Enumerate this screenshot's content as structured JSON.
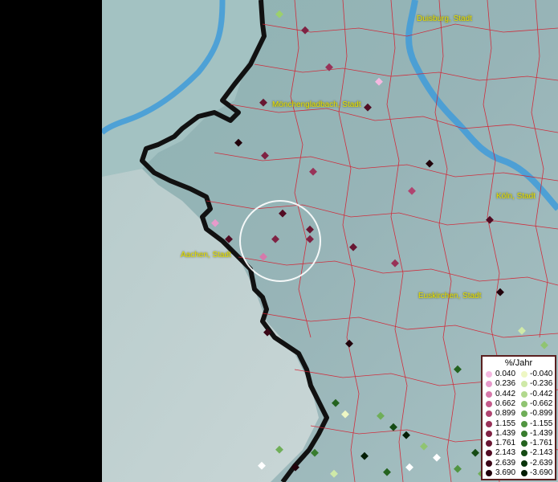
{
  "map": {
    "city_labels": [
      {
        "id": "duisburg",
        "text": "Duisburg, Stadt"
      },
      {
        "id": "moenchengladbach",
        "text": "Mönchengladbach, Stadt"
      },
      {
        "id": "koeln",
        "text": "Köln, Stadt"
      },
      {
        "id": "aachen",
        "text": "Aachen, Stadt"
      },
      {
        "id": "euskirchen",
        "text": "Euskirchen, Stadt"
      }
    ]
  },
  "legend": {
    "title": "%/Jahr",
    "positive": [
      {
        "label": "0.040",
        "color": "#f4b8e0"
      },
      {
        "label": "0.236",
        "color": "#e79acb"
      },
      {
        "label": "0.442",
        "color": "#d679aa"
      },
      {
        "label": "0.662",
        "color": "#c45b8b"
      },
      {
        "label": "0.899",
        "color": "#b04470"
      },
      {
        "label": "1.155",
        "color": "#983258"
      },
      {
        "label": "1.439",
        "color": "#7f2243"
      },
      {
        "label": "1.761",
        "color": "#681632"
      },
      {
        "label": "2.143",
        "color": "#520c23"
      },
      {
        "label": "2.639",
        "color": "#3a0616"
      },
      {
        "label": "3.690",
        "color": "#21020b"
      }
    ],
    "negative": [
      {
        "label": "-0.040",
        "color": "#eef7c4"
      },
      {
        "label": "-0.236",
        "color": "#cfe9a8"
      },
      {
        "label": "-0.442",
        "color": "#b2d98e"
      },
      {
        "label": "-0.662",
        "color": "#90c472"
      },
      {
        "label": "-0.899",
        "color": "#6fae58"
      },
      {
        "label": "-1.155",
        "color": "#519541"
      },
      {
        "label": "-1.439",
        "color": "#387c2e"
      },
      {
        "label": "-1.761",
        "color": "#24631f"
      },
      {
        "label": "-2.143",
        "color": "#154b14"
      },
      {
        "label": "-2.639",
        "color": "#0a340b"
      },
      {
        "label": "-3.690",
        "color": "#031d04"
      }
    ]
  }
}
